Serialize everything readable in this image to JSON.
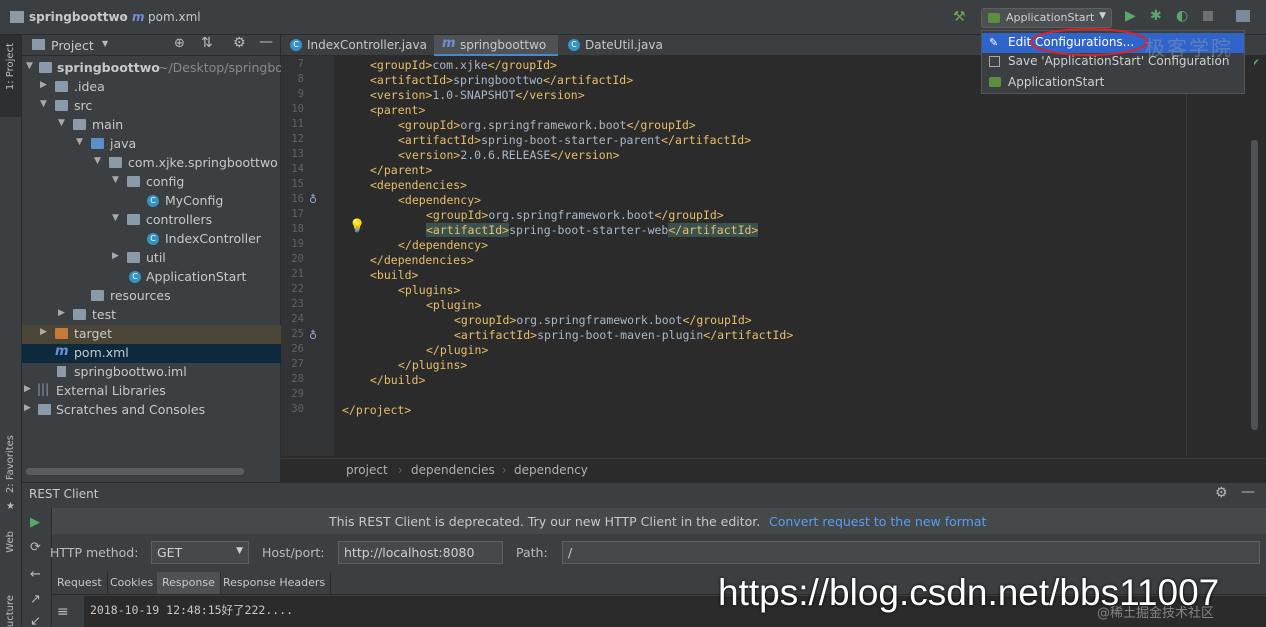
{
  "topbar": {
    "project_name": "springboottwo",
    "file_name": "pom.xml",
    "run_config": "ApplicationStart"
  },
  "run_menu": {
    "items": [
      "Edit Configurations...",
      "Save 'ApplicationStart' Configuration",
      "ApplicationStart"
    ]
  },
  "left_strip": {
    "project": "1: Project",
    "favorites": "2: Favorites",
    "web": "Web",
    "structure": "ucture"
  },
  "project_panel": {
    "title": "Project",
    "tree": [
      {
        "label": "springboottwo",
        "extra": "~/Desktop/springbo"
      },
      {
        "label": ".idea"
      },
      {
        "label": "src"
      },
      {
        "label": "main"
      },
      {
        "label": "java"
      },
      {
        "label": "com.xjke.springboottwo"
      },
      {
        "label": "config"
      },
      {
        "label": "MyConfig"
      },
      {
        "label": "controllers"
      },
      {
        "label": "IndexController"
      },
      {
        "label": "util"
      },
      {
        "label": "ApplicationStart"
      },
      {
        "label": "resources"
      },
      {
        "label": "test"
      },
      {
        "label": "target"
      },
      {
        "label": "pom.xml"
      },
      {
        "label": "springboottwo.iml"
      },
      {
        "label": "External Libraries"
      },
      {
        "label": "Scratches and Consoles"
      }
    ]
  },
  "editor": {
    "tabs": [
      "IndexController.java",
      "springboottwo",
      "DateUtil.java"
    ],
    "line_numbers": [
      "7",
      "8",
      "9",
      "10",
      "11",
      "12",
      "13",
      "14",
      "15",
      "16",
      "17",
      "18",
      "19",
      "20",
      "21",
      "22",
      "23",
      "24",
      "25",
      "26",
      "27",
      "28",
      "29",
      "30"
    ],
    "lines": [
      "<groupId>com.xjke</groupId>",
      "<artifactId>springboottwo</artifactId>",
      "<version>1.0-SNAPSHOT</version>",
      "<parent>",
      "<groupId>org.springframework.boot</groupId>",
      "<artifactId>spring-boot-starter-parent</artifactId>",
      "<version>2.0.6.RELEASE</version>",
      "</parent>",
      "<dependencies>",
      "<dependency>",
      "<groupId>org.springframework.boot</groupId>",
      "<artifactId>spring-boot-starter-web</artifactId>",
      "</dependency>",
      "</dependencies>",
      "<build>",
      "<plugins>",
      "<plugin>",
      "<groupId>org.springframework.boot</groupId>",
      "<artifactId>spring-boot-maven-plugin</artifactId>",
      "</plugin>",
      "</plugins>",
      "</build>",
      "",
      "</project>"
    ],
    "breadcrumb": [
      "project",
      "dependencies",
      "dependency"
    ]
  },
  "rest_client": {
    "title": "REST Client",
    "notice": "This REST Client is deprecated. Try our new HTTP Client in the editor.",
    "convert_link": "Convert request to the new format",
    "method_label": "HTTP method:",
    "method_value": "GET",
    "host_label": "Host/port:",
    "host_value": "http://localhost:8080",
    "path_label": "Path:",
    "path_value": "/",
    "subtabs": [
      "Request",
      "Cookies",
      "Response",
      "Response Headers"
    ],
    "response_line": "2018-10-19 12:48:15好了222...."
  },
  "watermarks": {
    "url": "https://blog.csdn.net/bbs11007",
    "juejin": "@稀土掘金技术社区",
    "top_logo": "极客学院"
  },
  "colors": {
    "accent": "#2f65ca",
    "link": "#589df6",
    "tag": "#e8bf6a"
  }
}
